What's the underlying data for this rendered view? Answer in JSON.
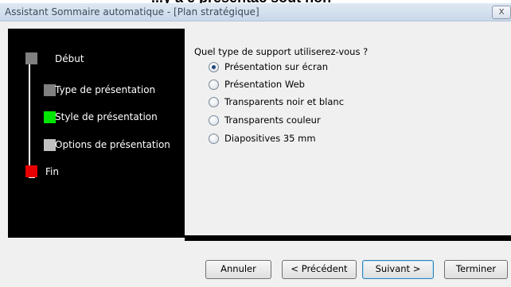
{
  "window": {
    "title": "Assistant Sommaire automatique - [Plan stratégique]",
    "close_label": "X",
    "top_ghost_text": "...y a e presentac sout non"
  },
  "steps": [
    {
      "label": "Début",
      "color": "#808080"
    },
    {
      "label": "Type de présentation",
      "color": "#808080"
    },
    {
      "label": "Style de présentation",
      "color": "#00e600"
    },
    {
      "label": "Options de présentation",
      "color": "#c0c0c0"
    },
    {
      "label": "Fin",
      "color": "#e60000"
    }
  ],
  "question": "Quel type de support utiliserez-vous ?",
  "options": [
    {
      "label": "Présentation sur écran",
      "selected": true
    },
    {
      "label": "Présentation Web",
      "selected": false
    },
    {
      "label": "Transparents noir et blanc",
      "selected": false
    },
    {
      "label": "Transparents couleur",
      "selected": false
    },
    {
      "label": "Diapositives 35 mm",
      "selected": false
    }
  ],
  "buttons": {
    "cancel": "Annuler",
    "previous": "< Précédent",
    "next": "Suivant >",
    "finish": "Terminer"
  }
}
